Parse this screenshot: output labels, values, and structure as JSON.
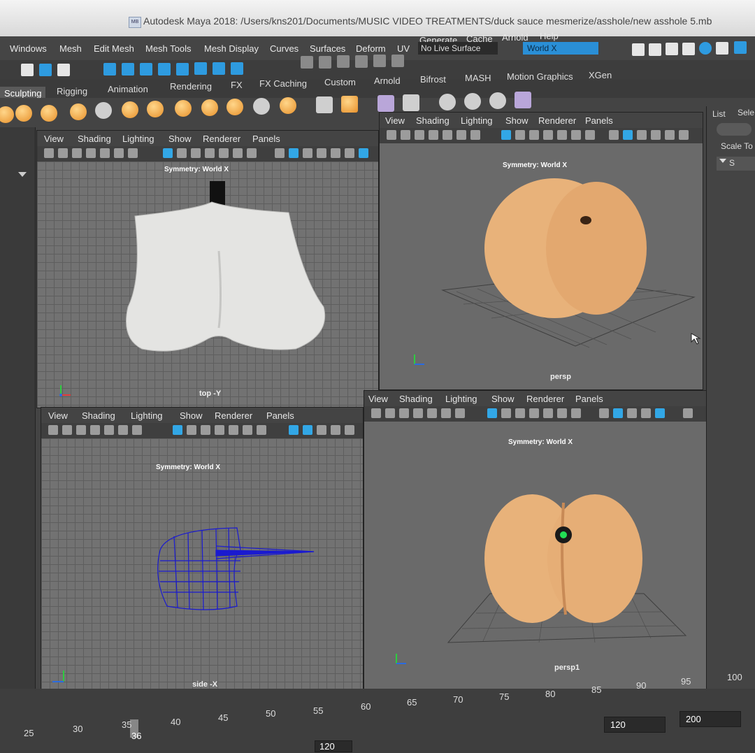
{
  "window": {
    "title": "Autodesk Maya 2018: /Users/kns201/Documents/MUSIC VIDEO TREATMENTS/duck sauce mesmerize/asshole/new asshole 5.mb",
    "app_icon": "maya-icon"
  },
  "menubar": {
    "items": [
      "Windows",
      "Mesh",
      "Edit Mesh",
      "Mesh Tools",
      "Mesh Display",
      "Curves",
      "Surfaces",
      "Deform",
      "UV",
      "Generate",
      "Cache",
      "Arnold",
      "Help"
    ],
    "live_surface": "No Live Surface",
    "symmetry_field": "World X"
  },
  "shelf_tabs": {
    "items": [
      "Sculpting",
      "Rigging",
      "Animation",
      "Rendering",
      "FX",
      "FX Caching",
      "Custom",
      "Arnold",
      "Bifrost",
      "MASH",
      "Motion Graphics",
      "XGen"
    ],
    "active": "Sculpting"
  },
  "panel_menu": [
    "View",
    "Shading",
    "Lighting",
    "Show",
    "Renderer",
    "Panels"
  ],
  "viewports": [
    {
      "id": "top",
      "camera": "top -Y",
      "symmetry": "Symmetry: World X"
    },
    {
      "id": "persp",
      "camera": "persp",
      "symmetry": "Symmetry: World X"
    },
    {
      "id": "side",
      "camera": "side -X",
      "symmetry": "Symmetry: World X"
    },
    {
      "id": "persp1",
      "camera": "persp1",
      "symmetry": "Symmetry: World X"
    }
  ],
  "right_panel": {
    "list": "List",
    "select": "Sele",
    "scale_tool": "Scale To",
    "section": "S"
  },
  "timeline": {
    "ticks": [
      "25",
      "30",
      "35",
      "40",
      "45",
      "50",
      "55",
      "60",
      "65",
      "70",
      "75",
      "80",
      "85",
      "90",
      "95",
      "100"
    ],
    "current_frame": "36",
    "range_end": "120",
    "playback_end": "120",
    "anim_end": "200"
  },
  "colors": {
    "accent": "#2e9be0",
    "wireframe": "#1a1ad0",
    "skin": "#e8b27a"
  }
}
